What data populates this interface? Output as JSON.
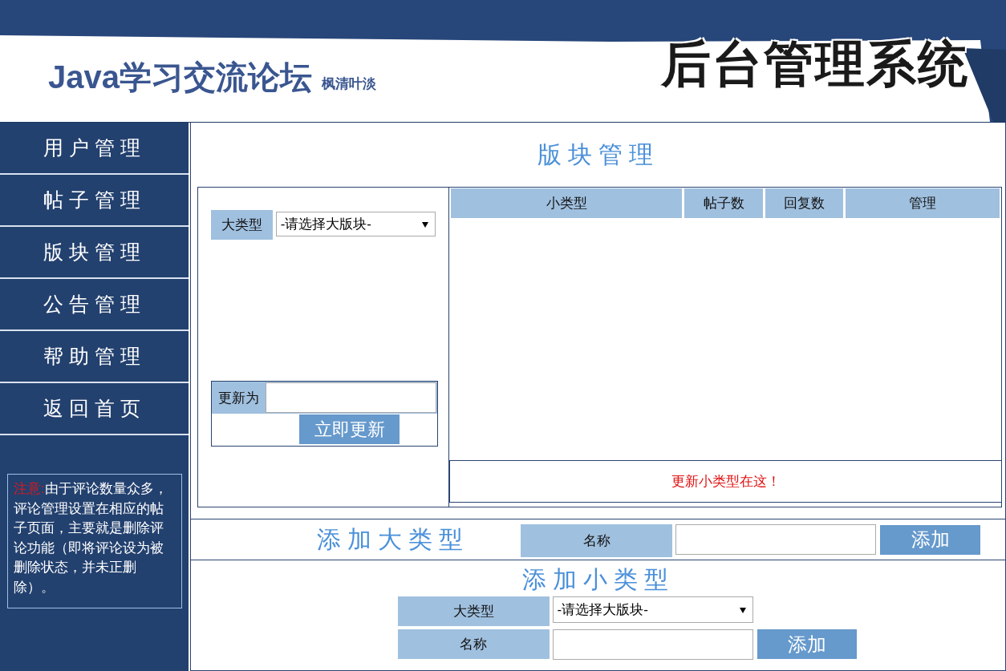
{
  "header": {
    "title": "Java学习交流论坛",
    "subtitle": "枫清叶淡",
    "system_name": "后台管理系统"
  },
  "sidebar": {
    "items": [
      {
        "label": "用户管理"
      },
      {
        "label": "帖子管理"
      },
      {
        "label": "版块管理"
      },
      {
        "label": "公告管理"
      },
      {
        "label": "帮助管理"
      },
      {
        "label": "返回首页"
      }
    ],
    "notice": {
      "label": "注意:",
      "text": "由于评论数量众多，评论管理设置在相应的帖子页面，主要就是删除评论功能（即将评论设为被删除状态，并未正删除）。"
    }
  },
  "page_title": "版块管理",
  "update_panel": {
    "category_label": "大类型",
    "category_select": "-请选择大版块-",
    "update_label": "更新为",
    "update_button": "立即更新"
  },
  "table": {
    "columns": [
      "小类型",
      "帖子数",
      "回复数",
      "管理"
    ],
    "footer_message": "更新小类型在这！"
  },
  "add_category": {
    "heading": "添加大类型",
    "name_label": "名称",
    "button": "添加"
  },
  "add_subcategory": {
    "heading": "添加小类型",
    "category_label": "大类型",
    "category_select": "-请选择大版块-",
    "name_label": "名称",
    "button": "添加"
  }
}
